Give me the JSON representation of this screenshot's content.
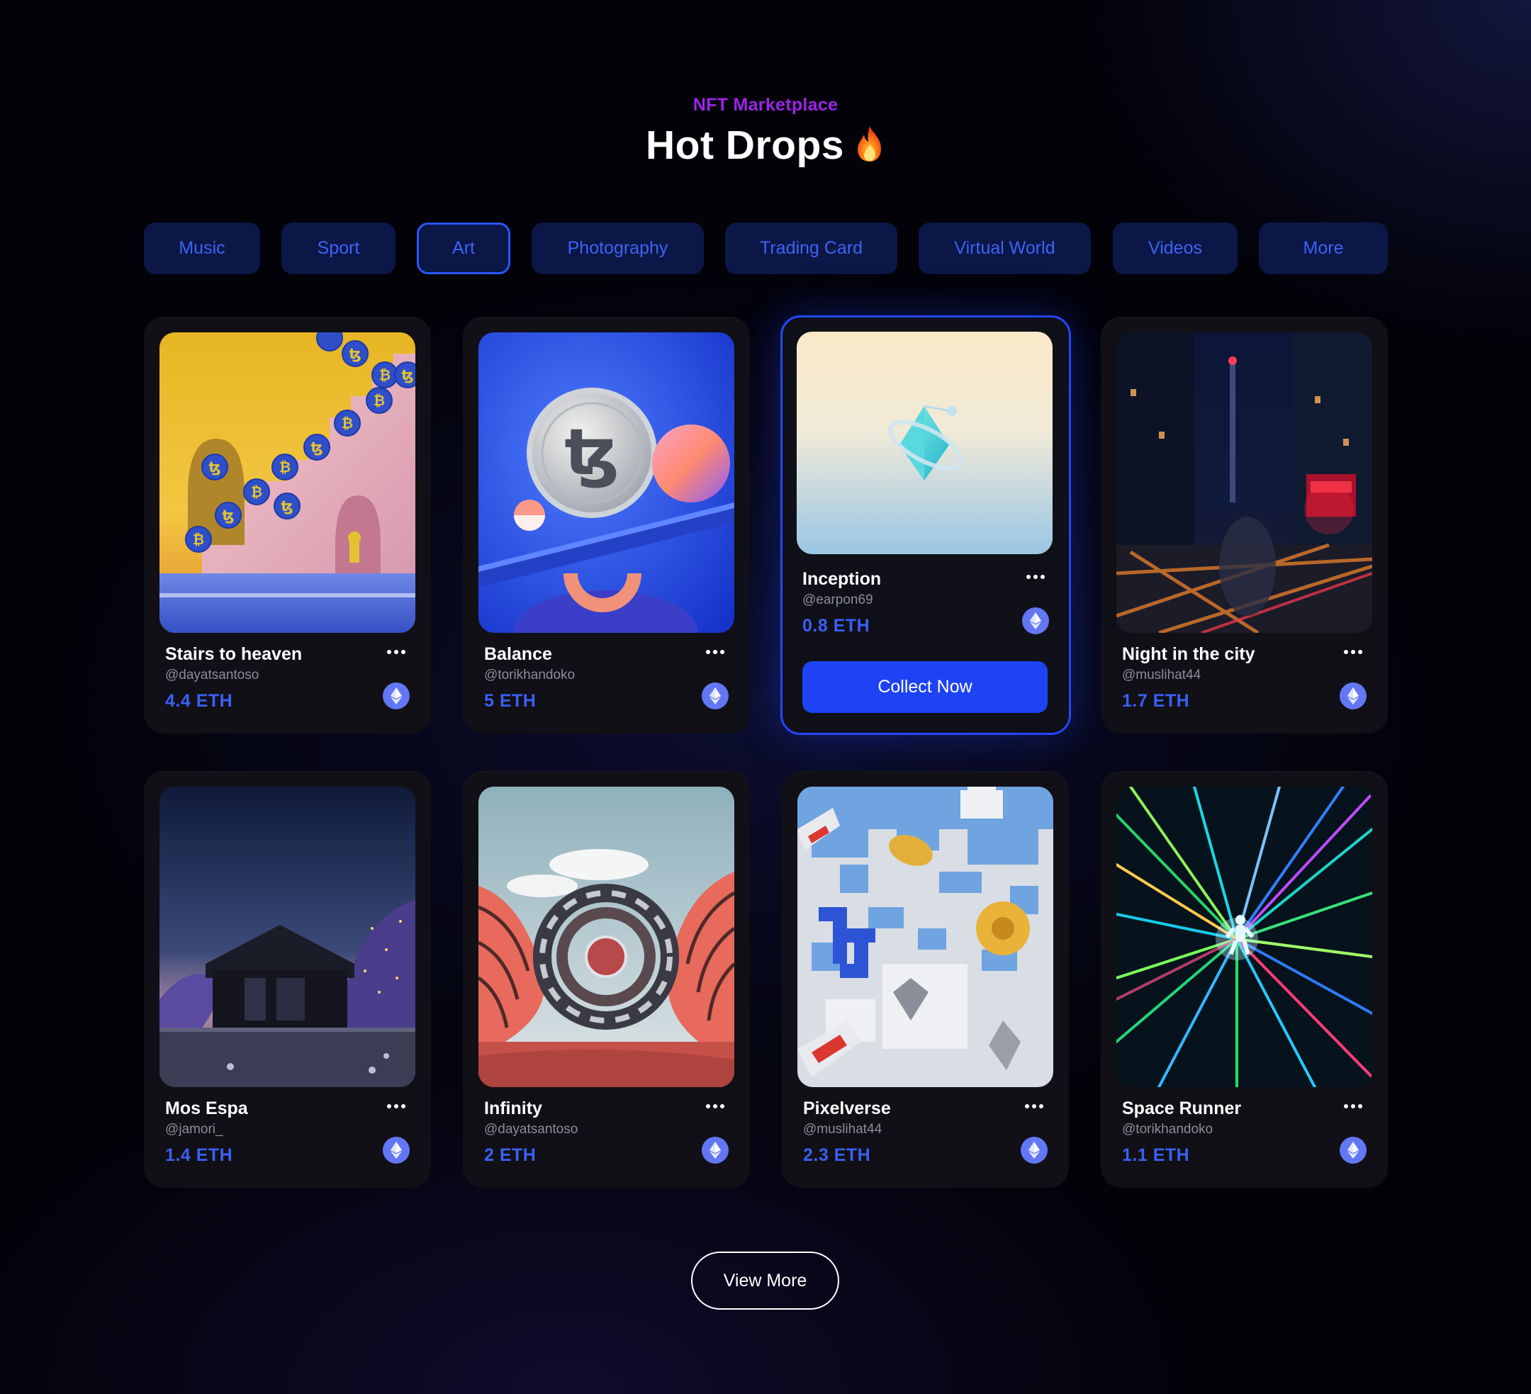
{
  "header": {
    "eyebrow": "NFT Marketplace",
    "title": "Hot Drops",
    "title_icon": "fire-icon"
  },
  "tabs": [
    {
      "label": "Music",
      "active": false
    },
    {
      "label": "Sport",
      "active": false
    },
    {
      "label": "Art",
      "active": true
    },
    {
      "label": "Photography",
      "active": false
    },
    {
      "label": "Trading Card",
      "active": false
    },
    {
      "label": "Virtual World",
      "active": false
    },
    {
      "label": "Videos",
      "active": false
    },
    {
      "label": "More",
      "active": false
    }
  ],
  "cards": [
    {
      "name": "Stairs to heaven",
      "handle": "@dayatsantoso",
      "price": "4.4 ETH"
    },
    {
      "name": "Balance",
      "handle": "@torikhandoko",
      "price": "5 ETH"
    },
    {
      "name": "Inception",
      "handle": "@earpon69",
      "price": "0.8 ETH",
      "featured": true,
      "cta": "Collect Now"
    },
    {
      "name": "Night in the city",
      "handle": "@muslihat44",
      "price": "1.7 ETH"
    },
    {
      "name": "Mos Espa",
      "handle": "@jamori_",
      "price": "1.4 ETH"
    },
    {
      "name": "Infinity",
      "handle": "@dayatsantoso",
      "price": "2 ETH"
    },
    {
      "name": "Pixelverse",
      "handle": "@muslihat44",
      "price": "2.3 ETH"
    },
    {
      "name": "Space Runner",
      "handle": "@torikhandoko",
      "price": "1.1 ETH"
    }
  ],
  "view_more": "View More",
  "colors": {
    "accent": "#1e43f5",
    "price": "#3a60f4",
    "eyebrow": "#9b25e6",
    "tab_bg": "#0b1746",
    "card_bg": "#101016"
  }
}
